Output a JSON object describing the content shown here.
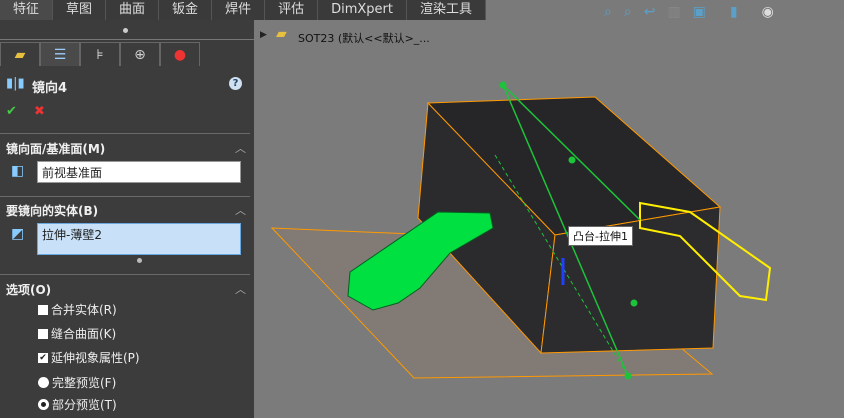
{
  "tabs": [
    "特征",
    "草图",
    "曲面",
    "钣金",
    "焊件",
    "评估",
    "DimXpert",
    "渲染工具"
  ],
  "feature": {
    "title": "镜向4",
    "help": "?",
    "ok": "✔",
    "cancel": "✖"
  },
  "mirror_face": {
    "title": "镜向面/基准面(M)",
    "value": "前视基准面"
  },
  "bodies": {
    "title": "要镜向的实体(B)",
    "value": "拉伸-薄壁2"
  },
  "options": {
    "title": "选项(O)",
    "checkboxes": [
      {
        "label": "合并实体(R)",
        "checked": false
      },
      {
        "label": "缝合曲面(K)",
        "checked": false
      },
      {
        "label": "延伸视象属性(P)",
        "checked": true
      }
    ],
    "radios": [
      {
        "label": "完整预览(F)",
        "selected": false
      },
      {
        "label": "部分预览(T)",
        "selected": true
      }
    ]
  },
  "tree": {
    "label": "SOT23  (默认<<默认>_..."
  },
  "tooltip": "凸台-拉伸1",
  "colors": {
    "preview": "#00e040",
    "selection": "#ffee00",
    "edge": "#ff9900"
  }
}
